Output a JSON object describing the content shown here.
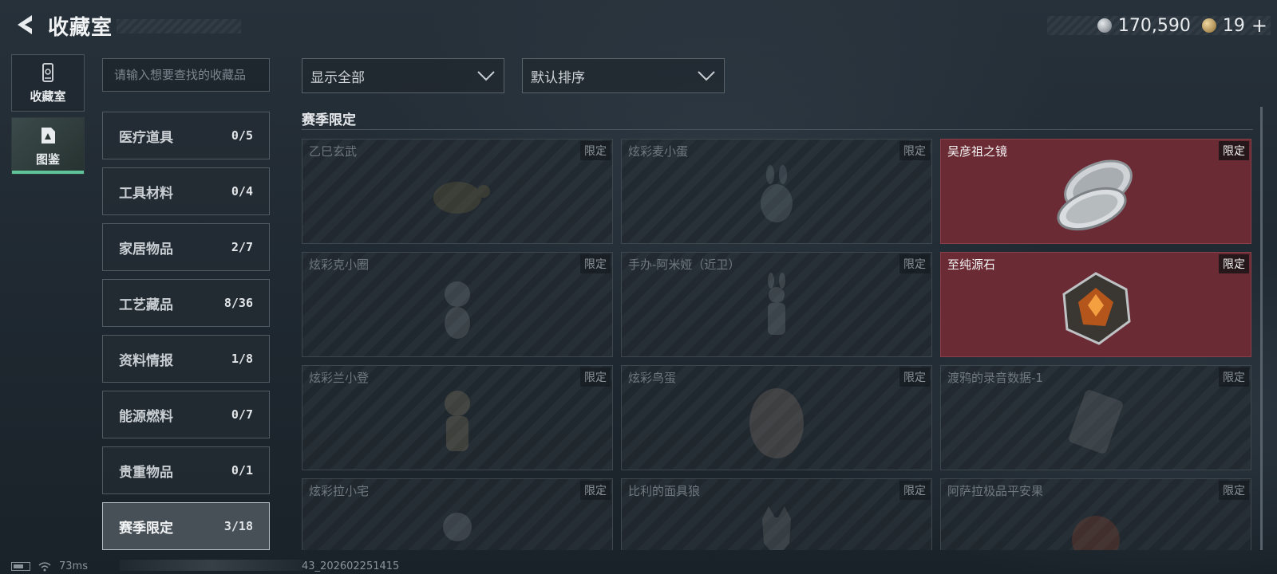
{
  "header": {
    "title": "收藏室"
  },
  "currency": {
    "coins": "170,590",
    "tickets": "19",
    "plus": "+"
  },
  "side_tabs": [
    {
      "label": "收藏室",
      "icon": "collection-room-icon"
    },
    {
      "label": "图鉴",
      "icon": "codex-icon"
    }
  ],
  "search": {
    "placeholder": "请输入想要查找的收藏品"
  },
  "categories": [
    {
      "name": "医疗道具",
      "count": "0/5"
    },
    {
      "name": "工具材料",
      "count": "0/4"
    },
    {
      "name": "家居物品",
      "count": "2/7"
    },
    {
      "name": "工艺藏品",
      "count": "8/36"
    },
    {
      "name": "资料情报",
      "count": "1/8"
    },
    {
      "name": "能源燃料",
      "count": "0/7"
    },
    {
      "name": "贵重物品",
      "count": "0/1"
    },
    {
      "name": "赛季限定",
      "count": "3/18"
    }
  ],
  "filters": {
    "show": "显示全部",
    "sort": "默认排序"
  },
  "section": {
    "title": "赛季限定"
  },
  "items": [
    {
      "name": "乙巳玄武",
      "tag": "限定",
      "owned": false
    },
    {
      "name": "炫彩麦小蛋",
      "tag": "限定",
      "owned": false
    },
    {
      "name": "吴彦祖之镜",
      "tag": "限定",
      "owned": true
    },
    {
      "name": "炫彩克小圈",
      "tag": "限定",
      "owned": false
    },
    {
      "name": "手办-阿米娅（近卫）",
      "tag": "限定",
      "owned": false
    },
    {
      "name": "至纯源石",
      "tag": "限定",
      "owned": true
    },
    {
      "name": "炫彩兰小登",
      "tag": "限定",
      "owned": false
    },
    {
      "name": "炫彩鸟蛋",
      "tag": "限定",
      "owned": false
    },
    {
      "name": "渡鸦的录音数据-1",
      "tag": "限定",
      "owned": false
    },
    {
      "name": "炫彩拉小宅",
      "tag": "限定",
      "owned": false
    },
    {
      "name": "比利的面具狼",
      "tag": "限定",
      "owned": false
    },
    {
      "name": "阿萨拉极品平安果",
      "tag": "限定",
      "owned": false
    }
  ],
  "footer": {
    "ping": "73ms",
    "build": "43_202602251415"
  }
}
